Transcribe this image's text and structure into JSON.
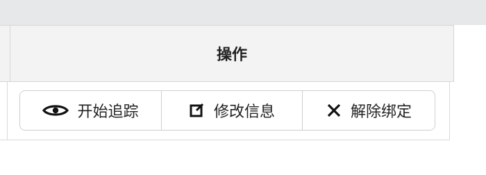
{
  "table": {
    "header": {
      "op_label": "操作"
    },
    "actions": [
      {
        "icon": "eye-icon",
        "label": "开始追踪"
      },
      {
        "icon": "edit-icon",
        "label": "修改信息"
      },
      {
        "icon": "close-icon",
        "label": "解除绑定"
      }
    ]
  }
}
